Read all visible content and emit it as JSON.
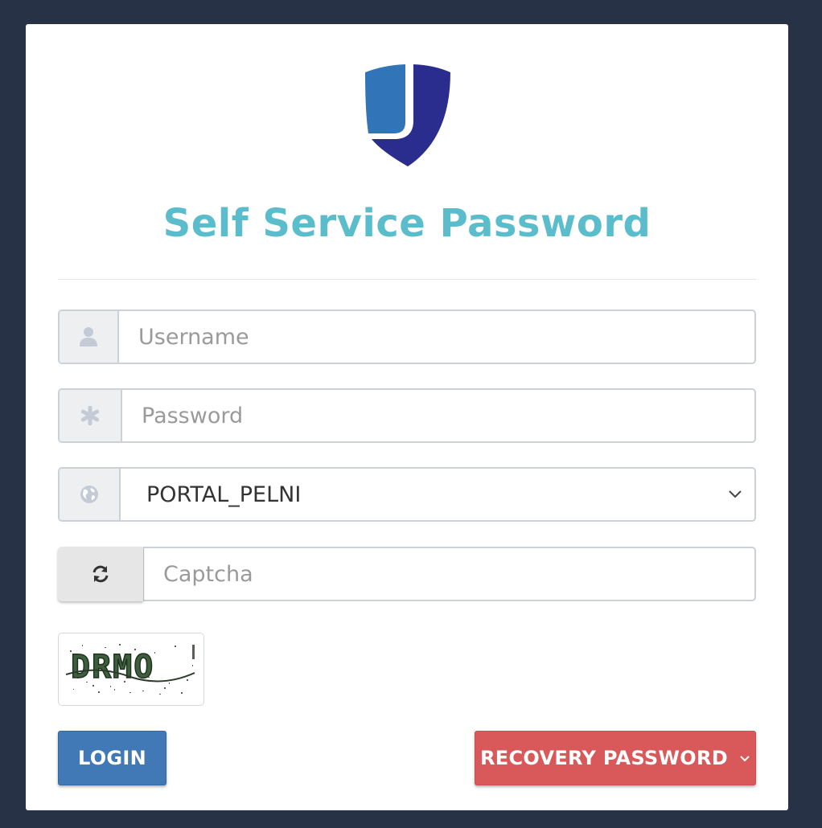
{
  "app": {
    "title": "Self Service Password"
  },
  "form": {
    "username": {
      "placeholder": "Username",
      "icon": "user-icon"
    },
    "password": {
      "placeholder": "Password",
      "icon": "asterisk-icon"
    },
    "domain": {
      "selected": "PORTAL_PELNI",
      "icon": "globe-icon"
    },
    "captcha": {
      "placeholder": "Captcha",
      "icon": "refresh-icon",
      "image_text": "DRMO"
    }
  },
  "buttons": {
    "login_label": "LOGIN",
    "recovery_label": "RECOVERY PASSWORD"
  },
  "colors": {
    "background": "#273246",
    "title": "#5bbccc",
    "login": "#4179b6",
    "recovery": "#d9585a",
    "logo_light": "#3274b8",
    "logo_dark": "#2b2d8e"
  }
}
